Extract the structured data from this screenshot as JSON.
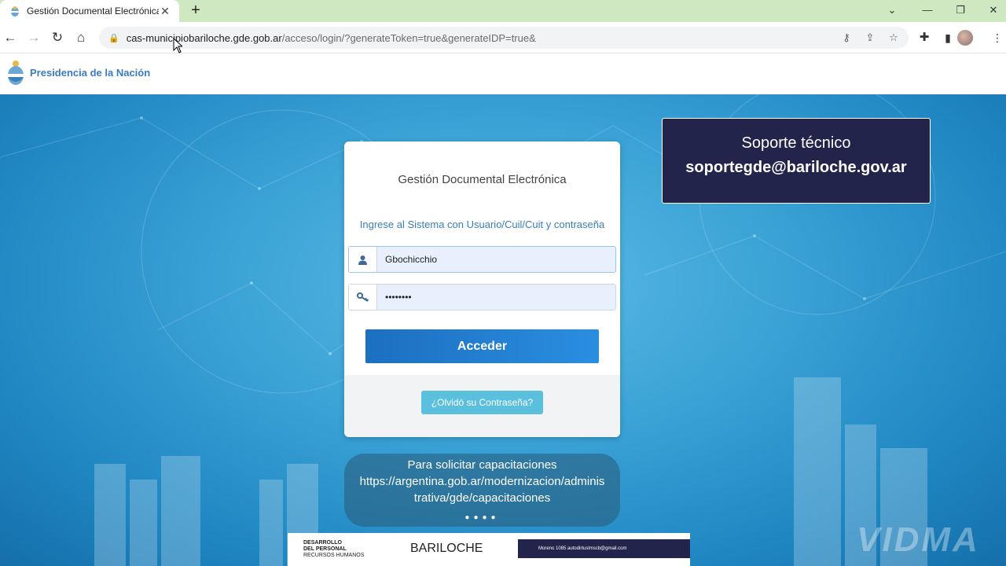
{
  "browser": {
    "tab_title": "Gestión Documental Electrónica",
    "tab_close": "✕",
    "new_tab": "+",
    "url_host": "cas-municipiobariloche.gde.gob.ar",
    "url_path": "/acceso/login/?generateToken=true&generateIDP=true&",
    "win_minimize": "—",
    "win_restore": "❐",
    "win_close": "✕",
    "win_tabsearch": "⌄",
    "nav_back": "←",
    "nav_forward": "→",
    "nav_reload": "↻",
    "nav_home": "⌂"
  },
  "header": {
    "title": "Presidencia de la Nación"
  },
  "login": {
    "title": "Gestión Documental Electrónica",
    "subtitle": "Ingrese al Sistema con Usuario/Cuil/Cuit y contraseña",
    "username_value": "Gbochicchio",
    "password_value": "••••••••",
    "submit_label": "Acceder",
    "forgot_label": "¿Olvidó su Contraseña?"
  },
  "support": {
    "line1": "Soporte técnico",
    "line2": "soportegde@bariloche.gov.ar"
  },
  "capacitaciones": {
    "line1": "Para solicitar capacitaciones",
    "line2": "https://argentina.gob.ar/modernizacion/adminis",
    "line3": "trativa/gde/capacitaciones",
    "dots": "●●●●"
  },
  "banner": {
    "left_line1": "DESARROLLO",
    "left_line2": "DEL PERSONAL",
    "left_line3": "RECURSOS HUMANOS",
    "mid": "BARILOCHE",
    "right": "Moreno 1085     autodirtuslmscb@gmail.com"
  },
  "watermark": "VIDMA",
  "colors": {
    "tabbar": "#cfe8c2",
    "accent_blue": "#1c6fc0",
    "support_bg": "#23244c",
    "forgot_bg": "#5bc0de"
  }
}
